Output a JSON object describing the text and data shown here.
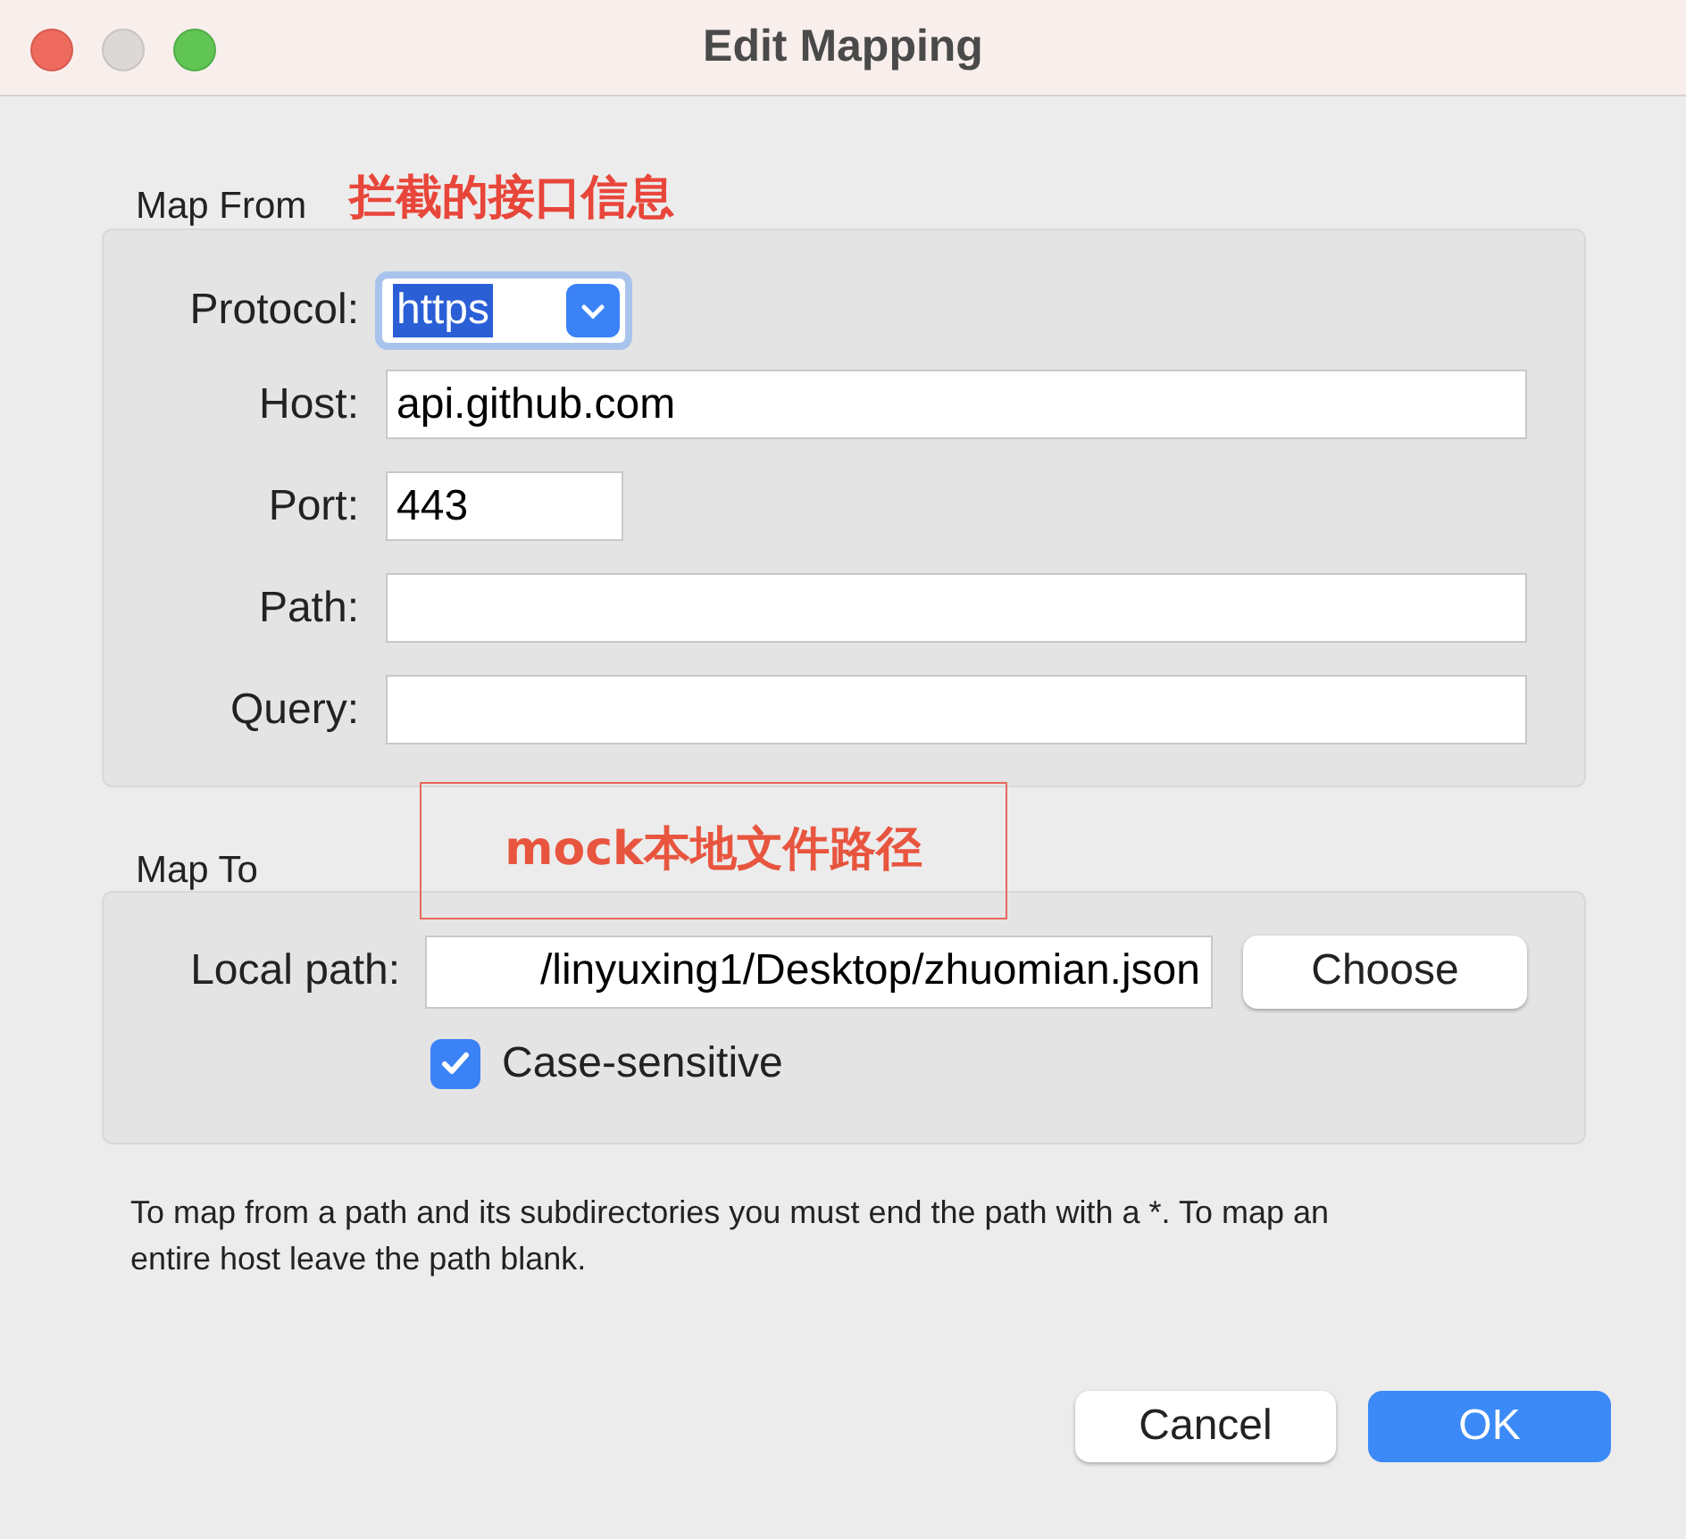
{
  "window": {
    "title": "Edit Mapping"
  },
  "map_from": {
    "label": "Map From",
    "annotation": "拦截的接口信息",
    "protocol": {
      "label": "Protocol:",
      "value": "https"
    },
    "fields": [
      {
        "label": "Host:",
        "value": "api.github.com",
        "kind": "wide"
      },
      {
        "label": "Port:",
        "value": "443",
        "kind": "short"
      },
      {
        "label": "Path:",
        "kind": "wide"
      },
      {
        "label": "Query:",
        "kind": "wide"
      }
    ]
  },
  "map_to": {
    "label": "Map To",
    "annotation": "mock本地文件路径",
    "local_path": {
      "label": "Local path:",
      "value": "/linyuxing1/Desktop/zhuomian.json"
    },
    "choose_button": "Choose",
    "case_sensitive": {
      "label": "Case-sensitive",
      "checked": true
    }
  },
  "note": "To map from a path and its subdirectories you must end the path with a *. To map an entire host leave the path blank.",
  "buttons": [
    {
      "label": "Cancel",
      "kind": "secondary"
    },
    {
      "label": "OK",
      "kind": "primary"
    }
  ]
}
